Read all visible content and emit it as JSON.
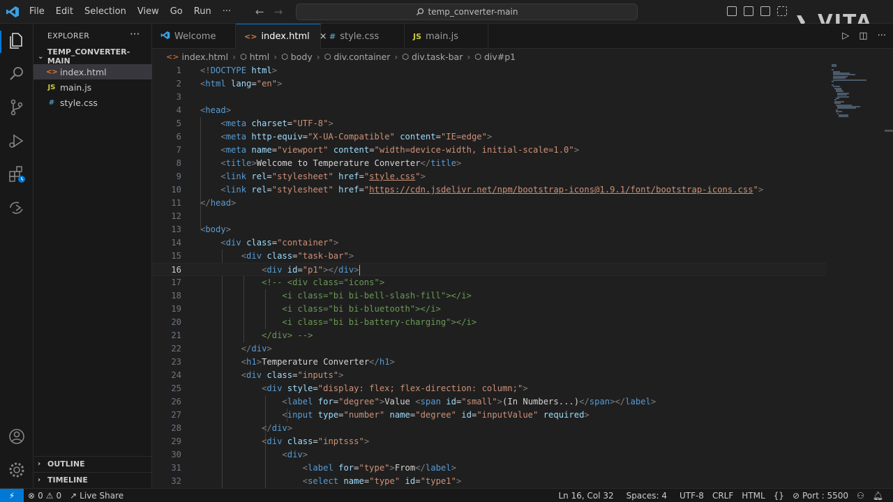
{
  "window": {
    "search_text": "temp_converter-main",
    "watermark": "VITA"
  },
  "menu": [
    "File",
    "Edit",
    "Selection",
    "View",
    "Go",
    "Run",
    "···"
  ],
  "sidebar": {
    "title": "EXPLORER",
    "more": "···",
    "folder": "TEMP_CONVERTER-MAIN",
    "files": [
      {
        "name": "index.html",
        "icon": "<>",
        "type": "html"
      },
      {
        "name": "main.js",
        "icon": "JS",
        "type": "js"
      },
      {
        "name": "style.css",
        "icon": "#",
        "type": "css"
      }
    ],
    "outline": "OUTLINE",
    "timeline": "TIMELINE"
  },
  "tabs": [
    {
      "label": "Welcome",
      "icon": "",
      "active": false
    },
    {
      "label": "index.html",
      "icon": "<>",
      "active": true,
      "close": "×"
    },
    {
      "label": "style.css",
      "icon": "#",
      "active": false
    },
    {
      "label": "main.js",
      "icon": "JS",
      "active": false
    }
  ],
  "breadcrumb": [
    "index.html",
    "html",
    "body",
    "div.container",
    "div.task-bar",
    "div#p1"
  ],
  "editor": {
    "current_line": 16,
    "lines": [
      {
        "n": "1",
        "tokens": [
          [
            "tg",
            "<!"
          ],
          [
            "tn",
            "DOCTYPE"
          ],
          [
            "tx",
            " "
          ],
          [
            "at",
            "html"
          ],
          [
            "tg",
            ">"
          ]
        ]
      },
      {
        "n": "2",
        "tokens": [
          [
            "tg",
            "<"
          ],
          [
            "tn",
            "html"
          ],
          [
            "tx",
            " "
          ],
          [
            "at",
            "lang"
          ],
          [
            "tx",
            "="
          ],
          [
            "st",
            "\"en\""
          ],
          [
            "tg",
            ">"
          ]
        ]
      },
      {
        "n": "3",
        "tokens": []
      },
      {
        "n": "4",
        "tokens": [
          [
            "tg",
            "<"
          ],
          [
            "tn",
            "head"
          ],
          [
            "tg",
            ">"
          ]
        ]
      },
      {
        "n": "5",
        "tokens": [
          [
            "tx",
            "    "
          ],
          [
            "tg",
            "<"
          ],
          [
            "tn",
            "meta"
          ],
          [
            "tx",
            " "
          ],
          [
            "at",
            "charset"
          ],
          [
            "tx",
            "="
          ],
          [
            "st",
            "\"UTF-8\""
          ],
          [
            "tg",
            ">"
          ]
        ]
      },
      {
        "n": "6",
        "tokens": [
          [
            "tx",
            "    "
          ],
          [
            "tg",
            "<"
          ],
          [
            "tn",
            "meta"
          ],
          [
            "tx",
            " "
          ],
          [
            "at",
            "http-equiv"
          ],
          [
            "tx",
            "="
          ],
          [
            "st",
            "\"X-UA-Compatible\""
          ],
          [
            "tx",
            " "
          ],
          [
            "at",
            "content"
          ],
          [
            "tx",
            "="
          ],
          [
            "st",
            "\"IE=edge\""
          ],
          [
            "tg",
            ">"
          ]
        ]
      },
      {
        "n": "7",
        "tokens": [
          [
            "tx",
            "    "
          ],
          [
            "tg",
            "<"
          ],
          [
            "tn",
            "meta"
          ],
          [
            "tx",
            " "
          ],
          [
            "at",
            "name"
          ],
          [
            "tx",
            "="
          ],
          [
            "st",
            "\"viewport\""
          ],
          [
            "tx",
            " "
          ],
          [
            "at",
            "content"
          ],
          [
            "tx",
            "="
          ],
          [
            "st",
            "\"width=device-width, initial-scale=1.0\""
          ],
          [
            "tg",
            ">"
          ]
        ]
      },
      {
        "n": "8",
        "tokens": [
          [
            "tx",
            "    "
          ],
          [
            "tg",
            "<"
          ],
          [
            "tn",
            "title"
          ],
          [
            "tg",
            ">"
          ],
          [
            "tx",
            "Welcome to Temperature Converter"
          ],
          [
            "tg",
            "</"
          ],
          [
            "tn",
            "title"
          ],
          [
            "tg",
            ">"
          ]
        ]
      },
      {
        "n": "9",
        "tokens": [
          [
            "tx",
            "    "
          ],
          [
            "tg",
            "<"
          ],
          [
            "tn",
            "link"
          ],
          [
            "tx",
            " "
          ],
          [
            "at",
            "rel"
          ],
          [
            "tx",
            "="
          ],
          [
            "st",
            "\"stylesheet\""
          ],
          [
            "tx",
            " "
          ],
          [
            "at",
            "href"
          ],
          [
            "tx",
            "="
          ],
          [
            "st",
            "\""
          ],
          [
            "st ul",
            "style.css"
          ],
          [
            "st",
            "\""
          ],
          [
            "tg",
            ">"
          ]
        ]
      },
      {
        "n": "10",
        "tokens": [
          [
            "tx",
            "    "
          ],
          [
            "tg",
            "<"
          ],
          [
            "tn",
            "link"
          ],
          [
            "tx",
            " "
          ],
          [
            "at",
            "rel"
          ],
          [
            "tx",
            "="
          ],
          [
            "st",
            "\"stylesheet\""
          ],
          [
            "tx",
            " "
          ],
          [
            "at",
            "href"
          ],
          [
            "tx",
            "="
          ],
          [
            "st",
            "\""
          ],
          [
            "st ul",
            "https://cdn.jsdelivr.net/npm/bootstrap-icons@1.9.1/font/bootstrap-icons.css"
          ],
          [
            "st",
            "\""
          ],
          [
            "tg",
            ">"
          ]
        ]
      },
      {
        "n": "11",
        "tokens": [
          [
            "tg",
            "</"
          ],
          [
            "tn",
            "head"
          ],
          [
            "tg",
            ">"
          ]
        ]
      },
      {
        "n": "12",
        "tokens": []
      },
      {
        "n": "13",
        "tokens": [
          [
            "tg",
            "<"
          ],
          [
            "tn",
            "body"
          ],
          [
            "tg",
            ">"
          ]
        ]
      },
      {
        "n": "14",
        "tokens": [
          [
            "tx",
            "    "
          ],
          [
            "tg",
            "<"
          ],
          [
            "tn",
            "div"
          ],
          [
            "tx",
            " "
          ],
          [
            "at",
            "class"
          ],
          [
            "tx",
            "="
          ],
          [
            "st",
            "\"container\""
          ],
          [
            "tg",
            ">"
          ]
        ]
      },
      {
        "n": "15",
        "tokens": [
          [
            "tx",
            "        "
          ],
          [
            "tg",
            "<"
          ],
          [
            "tn",
            "div"
          ],
          [
            "tx",
            " "
          ],
          [
            "at",
            "class"
          ],
          [
            "tx",
            "="
          ],
          [
            "st",
            "\"task-bar\""
          ],
          [
            "tg",
            ">"
          ]
        ]
      },
      {
        "n": "16",
        "tokens": [
          [
            "tx",
            "            "
          ],
          [
            "tg",
            "<"
          ],
          [
            "tn",
            "div"
          ],
          [
            "tx",
            " "
          ],
          [
            "at",
            "id"
          ],
          [
            "tx",
            "="
          ],
          [
            "st",
            "\"p1\""
          ],
          [
            "tg",
            "></"
          ],
          [
            "tn",
            "div"
          ],
          [
            "tg",
            ">"
          ]
        ]
      },
      {
        "n": "17",
        "tokens": [
          [
            "tx",
            "            "
          ],
          [
            "cm",
            "<!-- <div class=\"icons\">"
          ]
        ]
      },
      {
        "n": "18",
        "tokens": [
          [
            "tx",
            "                "
          ],
          [
            "cm",
            "<i class=\"bi bi-bell-slash-fill\"></i>"
          ]
        ]
      },
      {
        "n": "19",
        "tokens": [
          [
            "tx",
            "                "
          ],
          [
            "cm",
            "<i class=\"bi bi-bluetooth\"></i>"
          ]
        ]
      },
      {
        "n": "20",
        "tokens": [
          [
            "tx",
            "                "
          ],
          [
            "cm",
            "<i class=\"bi bi-battery-charging\"></i>"
          ]
        ]
      },
      {
        "n": "21",
        "tokens": [
          [
            "tx",
            "            "
          ],
          [
            "cm",
            "</div> -->"
          ]
        ]
      },
      {
        "n": "22",
        "tokens": [
          [
            "tx",
            "        "
          ],
          [
            "tg",
            "</"
          ],
          [
            "tn",
            "div"
          ],
          [
            "tg",
            ">"
          ]
        ]
      },
      {
        "n": "23",
        "tokens": [
          [
            "tx",
            "        "
          ],
          [
            "tg",
            "<"
          ],
          [
            "tn",
            "h1"
          ],
          [
            "tg",
            ">"
          ],
          [
            "tx",
            "Temperature Converter"
          ],
          [
            "tg",
            "</"
          ],
          [
            "tn",
            "h1"
          ],
          [
            "tg",
            ">"
          ]
        ]
      },
      {
        "n": "24",
        "tokens": [
          [
            "tx",
            "        "
          ],
          [
            "tg",
            "<"
          ],
          [
            "tn",
            "div"
          ],
          [
            "tx",
            " "
          ],
          [
            "at",
            "class"
          ],
          [
            "tx",
            "="
          ],
          [
            "st",
            "\"inputs\""
          ],
          [
            "tg",
            ">"
          ]
        ]
      },
      {
        "n": "25",
        "tokens": [
          [
            "tx",
            "            "
          ],
          [
            "tg",
            "<"
          ],
          [
            "tn",
            "div"
          ],
          [
            "tx",
            " "
          ],
          [
            "at",
            "style"
          ],
          [
            "tx",
            "="
          ],
          [
            "st",
            "\"display: flex; flex-direction: column;\""
          ],
          [
            "tg",
            ">"
          ]
        ]
      },
      {
        "n": "26",
        "tokens": [
          [
            "tx",
            "                "
          ],
          [
            "tg",
            "<"
          ],
          [
            "tn",
            "label"
          ],
          [
            "tx",
            " "
          ],
          [
            "at",
            "for"
          ],
          [
            "tx",
            "="
          ],
          [
            "st",
            "\"degree\""
          ],
          [
            "tg",
            ">"
          ],
          [
            "tx",
            "Value "
          ],
          [
            "tg",
            "<"
          ],
          [
            "tn",
            "span"
          ],
          [
            "tx",
            " "
          ],
          [
            "at",
            "id"
          ],
          [
            "tx",
            "="
          ],
          [
            "st",
            "\"small\""
          ],
          [
            "tg",
            ">"
          ],
          [
            "tx",
            "(In Numbers...)"
          ],
          [
            "tg",
            "</"
          ],
          [
            "tn",
            "span"
          ],
          [
            "tg",
            "></"
          ],
          [
            "tn",
            "label"
          ],
          [
            "tg",
            ">"
          ]
        ]
      },
      {
        "n": "27",
        "tokens": [
          [
            "tx",
            "                "
          ],
          [
            "tg",
            "<"
          ],
          [
            "tn",
            "input"
          ],
          [
            "tx",
            " "
          ],
          [
            "at",
            "type"
          ],
          [
            "tx",
            "="
          ],
          [
            "st",
            "\"number\""
          ],
          [
            "tx",
            " "
          ],
          [
            "at",
            "name"
          ],
          [
            "tx",
            "="
          ],
          [
            "st",
            "\"degree\""
          ],
          [
            "tx",
            " "
          ],
          [
            "at",
            "id"
          ],
          [
            "tx",
            "="
          ],
          [
            "st",
            "\"inputValue\""
          ],
          [
            "tx",
            " "
          ],
          [
            "at",
            "required"
          ],
          [
            "tg",
            ">"
          ]
        ]
      },
      {
        "n": "28",
        "tokens": [
          [
            "tx",
            "            "
          ],
          [
            "tg",
            "</"
          ],
          [
            "tn",
            "div"
          ],
          [
            "tg",
            ">"
          ]
        ]
      },
      {
        "n": "29",
        "tokens": [
          [
            "tx",
            "            "
          ],
          [
            "tg",
            "<"
          ],
          [
            "tn",
            "div"
          ],
          [
            "tx",
            " "
          ],
          [
            "at",
            "class"
          ],
          [
            "tx",
            "="
          ],
          [
            "st",
            "\"inptsss\""
          ],
          [
            "tg",
            ">"
          ]
        ]
      },
      {
        "n": "30",
        "tokens": [
          [
            "tx",
            "                "
          ],
          [
            "tg",
            "<"
          ],
          [
            "tn",
            "div"
          ],
          [
            "tg",
            ">"
          ]
        ]
      },
      {
        "n": "31",
        "tokens": [
          [
            "tx",
            "                    "
          ],
          [
            "tg",
            "<"
          ],
          [
            "tn",
            "label"
          ],
          [
            "tx",
            " "
          ],
          [
            "at",
            "for"
          ],
          [
            "tx",
            "="
          ],
          [
            "st",
            "\"type\""
          ],
          [
            "tg",
            ">"
          ],
          [
            "tx",
            "From"
          ],
          [
            "tg",
            "</"
          ],
          [
            "tn",
            "label"
          ],
          [
            "tg",
            ">"
          ]
        ]
      },
      {
        "n": "32",
        "tokens": [
          [
            "tx",
            "                    "
          ],
          [
            "tg",
            "<"
          ],
          [
            "tn",
            "select"
          ],
          [
            "tx",
            " "
          ],
          [
            "at",
            "name"
          ],
          [
            "tx",
            "="
          ],
          [
            "st",
            "\"type\""
          ],
          [
            "tx",
            " "
          ],
          [
            "at",
            "id"
          ],
          [
            "tx",
            "="
          ],
          [
            "st",
            "\"type1\""
          ],
          [
            "tg",
            ">"
          ]
        ]
      }
    ]
  },
  "statusbar": {
    "errors": "0",
    "warnings": "0",
    "live_share": "Live Share",
    "position": "Ln 16, Col 32",
    "spaces": "Spaces: 4",
    "encoding": "UTF-8",
    "eol": "CRLF",
    "language": "HTML",
    "port": "Port : 5500"
  },
  "colors": {
    "accent": "#0078d4",
    "background": "#1f1f1f",
    "sidebar_bg": "#181818",
    "tag": "#569cd6",
    "attribute": "#9cdcfe",
    "string": "#ce9178",
    "comment": "#6a9955"
  }
}
